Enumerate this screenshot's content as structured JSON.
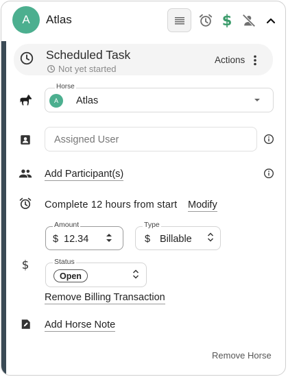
{
  "header": {
    "avatar_initial": "A",
    "title": "Atlas",
    "icons": [
      "list-icon",
      "alarm-clock-icon",
      "dollar-icon",
      "no-person-icon",
      "chevron-up-icon"
    ]
  },
  "task": {
    "title": "Scheduled Task",
    "status": "Not yet started",
    "actions_label": "Actions"
  },
  "horse": {
    "label": "Horse",
    "avatar_initial": "A",
    "value": "Atlas"
  },
  "assigned_user": {
    "placeholder": "Assigned User"
  },
  "participants": {
    "link": "Add Participant(s)"
  },
  "schedule": {
    "text": "Complete 12 hours from start",
    "modify_link": "Modify"
  },
  "billing": {
    "amount_label": "Amount",
    "currency_symbol": "$",
    "amount_value": "12.34",
    "type_label": "Type",
    "type_value": "Billable",
    "status_label": "Status",
    "status_value": "Open",
    "remove_link": "Remove Billing Transaction"
  },
  "note": {
    "link": "Add Horse Note"
  },
  "footer": {
    "remove_horse": "Remove Horse"
  },
  "colors": {
    "accent_bar": "#3a4a55",
    "avatar": "#4caf8f",
    "dollar_green": "#3b9b6b"
  }
}
